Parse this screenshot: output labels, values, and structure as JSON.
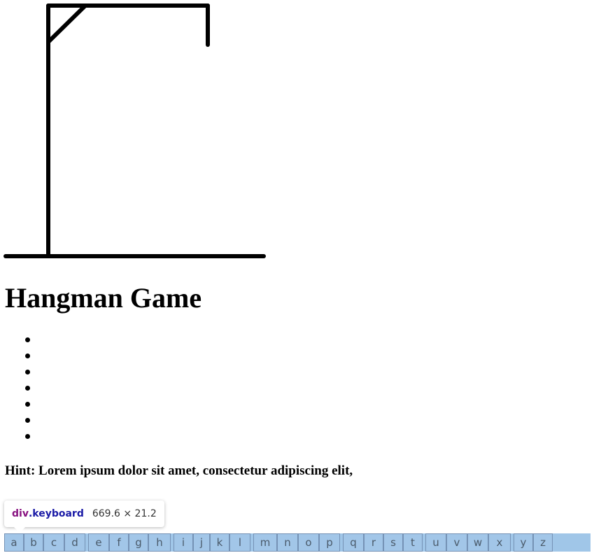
{
  "title": "Hangman Game",
  "word_slots": [
    "",
    "",
    "",
    "",
    "",
    "",
    ""
  ],
  "hint": "Hint: Lorem ipsum dolor sit amet, consectetur adipiscing elit,",
  "devtools_tooltip": {
    "tag": "div",
    "class_name": ".keyboard",
    "size": "669.6 × 21.2"
  },
  "keyboard": {
    "keys": [
      "a",
      "b",
      "c",
      "d",
      "e",
      "f",
      "g",
      "h",
      "i",
      "j",
      "k",
      "l",
      "m",
      "n",
      "o",
      "p",
      "q",
      "r",
      "s",
      "t",
      "u",
      "v",
      "w",
      "x",
      "y",
      "z"
    ]
  },
  "colors": {
    "highlight": "#a0c4e8",
    "tooltip_tag": "#881280",
    "tooltip_class": "#1a1aa6"
  }
}
